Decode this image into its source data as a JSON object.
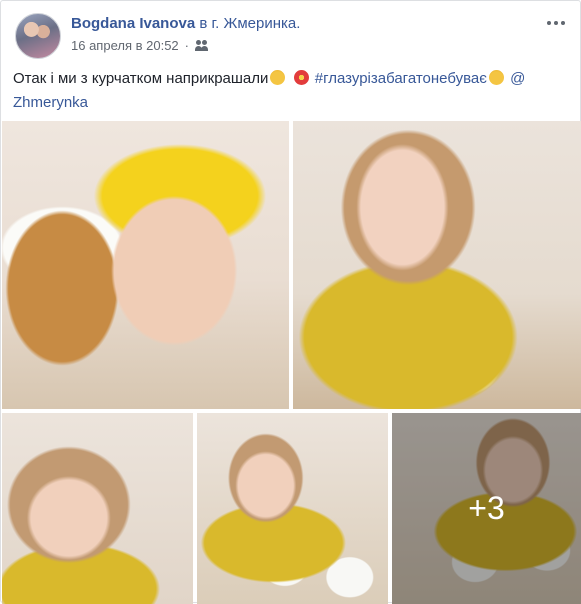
{
  "post": {
    "author": "Bogdana Ivanova",
    "location_prefix": "в г.",
    "location": "Жмеринка.",
    "timestamp": "16 апреля в 20:52",
    "privacy_icon": "friends-icon",
    "more_icon": "more-options-icon",
    "text_part1": "Отак і ми з курчатком наприкрашали",
    "text_hashtag": "#глазурізабагатонебуває",
    "text_mention": "@ Zhmerynka"
  },
  "photos": {
    "count": 5,
    "more_count": "+3"
  },
  "colors": {
    "link": "#385898",
    "meta": "#616770",
    "text": "#1d2129"
  }
}
